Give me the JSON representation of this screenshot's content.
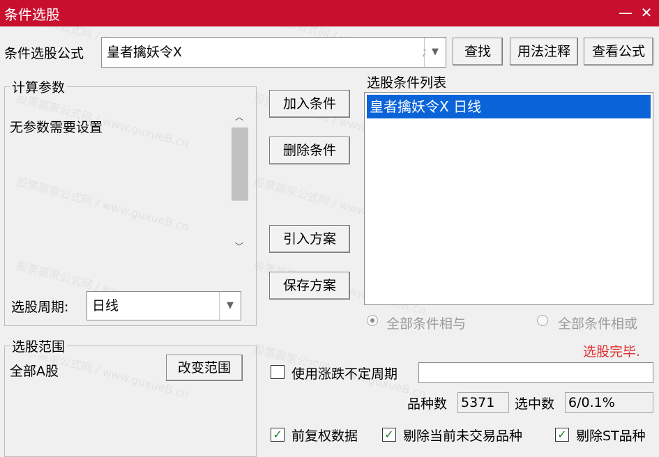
{
  "window": {
    "title": "条件选股",
    "minimize": "—",
    "close": "✕"
  },
  "formula": {
    "label": "条件选股公式",
    "value": "皇者擒妖令X",
    "cursor": ";"
  },
  "buttons": {
    "find": "查找",
    "usage": "用法注释",
    "view_formula": "查看公式",
    "add_condition": "加入条件",
    "delete_condition": "删除条件",
    "import_plan": "引入方案",
    "save_plan": "保存方案",
    "change_range": "改变范围"
  },
  "params": {
    "legend": "计算参数",
    "message": "无参数需要设置",
    "period_label": "选股周期:",
    "period_value": "日线"
  },
  "scope": {
    "legend": "选股范围",
    "value": "全部A股"
  },
  "conditions": {
    "label": "选股条件列表",
    "items": [
      "皇者擒妖令X  日线"
    ]
  },
  "logic": {
    "and_label": "全部条件相与",
    "or_label": "全部条件相或",
    "selected": "and"
  },
  "status": {
    "text": "选股完毕.",
    "color": "#e03030"
  },
  "uncertain": {
    "label": "使用涨跌不定周期",
    "value": ""
  },
  "stats": {
    "count_label": "品种数",
    "count_value": "5371",
    "selected_label": "选中数",
    "selected_value": "6/0.1%"
  },
  "options": {
    "adjusted": "前复权数据",
    "exclude_untraded": "剔除当前未交易品种",
    "exclude_st": "剔除ST品种"
  },
  "watermark": {
    "text": "股票赢家公式网 / www.guxueB.cn"
  }
}
